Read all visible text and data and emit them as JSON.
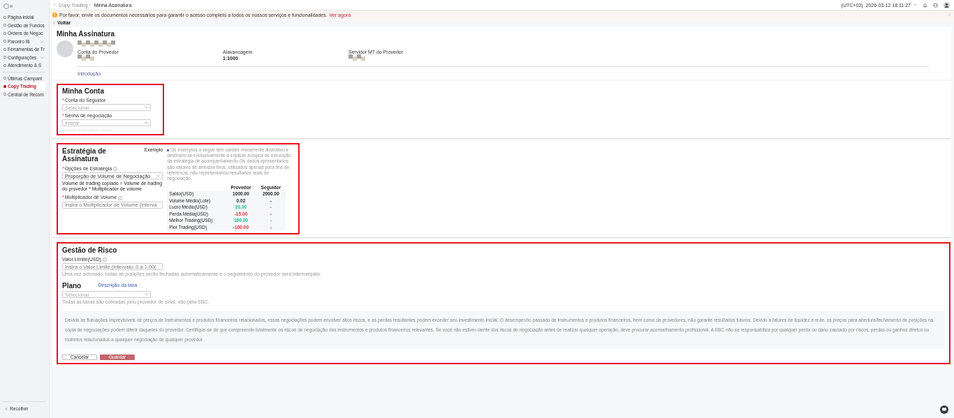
{
  "sidebar": {
    "groups": [
      {
        "items": [
          {
            "label": "Página inicial",
            "selected": false,
            "expandable": false
          },
          {
            "label": "Gestão de Fundos",
            "selected": false,
            "expandable": false
          },
          {
            "label": "Ordens de Negoc",
            "selected": false,
            "expandable": false
          },
          {
            "label": "Parceiro IB",
            "selected": false,
            "expandable": true
          },
          {
            "label": "Ferramentas de Tr",
            "selected": false,
            "expandable": false
          },
          {
            "label": "Configurações",
            "selected": false,
            "expandable": true
          },
          {
            "label": "Atendimento & S",
            "selected": false,
            "expandable": false
          }
        ]
      },
      {
        "items": [
          {
            "label": "Últimas Campant",
            "selected": false,
            "expandable": false
          },
          {
            "label": "Copy Trading",
            "selected": true,
            "expandable": false
          },
          {
            "label": "Central de Recom",
            "selected": false,
            "expandable": false
          }
        ]
      }
    ],
    "collapse": "Recolher"
  },
  "breadcrumb": [
    {
      "label": "Copy Trading",
      "current": false
    },
    {
      "label": "Minha Assinatura",
      "current": true
    }
  ],
  "header": {
    "timezone": "(UTC+03)",
    "datetime": "2026-03-12 18:11:27"
  },
  "notice": {
    "text": "Por favor, envie os documentos necessários para garantir o acesso completo a todos os nossos serviços e funcionalidades.",
    "link": "Ver agora"
  },
  "back": "Voltar",
  "subscription": {
    "title": "Minha Assinatura",
    "fields": [
      {
        "label": "Conta do Provedor"
      },
      {
        "label": "Alavancagem",
        "value": "1:1000"
      },
      {
        "label": "Servidor MT do Provedor"
      }
    ],
    "tab": "Introdução"
  },
  "my_account": {
    "title": "Minha Conta",
    "highlighted": true,
    "fields": [
      {
        "label": "Conta do Seguidor",
        "required_mark": "*",
        "kind": "select",
        "placeholder": "Selecionar"
      },
      {
        "label": "Senha de negociação",
        "required_mark": "*",
        "kind": "password",
        "placeholder": "Insirar"
      }
    ]
  },
  "strategy": {
    "title": "Estratégia de Assinatura",
    "highlighted": true,
    "example_label": "Exemplo",
    "options_label": "Opções de Estratégia",
    "options_required_mark": "*",
    "multiplier_required_mark": "*",
    "option_value": "Proporção de Volume de Negociação",
    "formula": "Volume de trading copiado = Volume de trading do provedor * Multiplicador de volume",
    "multiplier_label": "Multiplicador de Volume",
    "multiplier_placeholder": "Insira o Multiplicador de Volume (interva",
    "example_note": "Os exemplos a seguir têm caráter meramente ilustrativo e destinam-se exclusivamente a explicar a lógica de execução da estratégia de acompanhamento.Os dados apresentados são valores de amostra fixos, utilizados apenas para fins de referência, não representando resultados reais de negociação.",
    "table": {
      "columns": [
        "Provedor",
        "Seguidor"
      ],
      "rows": [
        {
          "label": "Saldo(USD)",
          "provider": {
            "text": "1000.00",
            "kind": "neutral"
          },
          "follower": {
            "text": "2000.00",
            "kind": "neutral"
          }
        },
        {
          "label": "Volume Médio(Lote)",
          "provider": {
            "text": "0.02",
            "kind": "neutral"
          },
          "follower": {
            "text": "-",
            "kind": "neutral"
          }
        },
        {
          "label": "Lucro Médio(USD)",
          "provider": {
            "text": "20.00",
            "kind": "gain"
          },
          "follower": {
            "text": "-",
            "kind": "gain"
          }
        },
        {
          "label": "Perda Média(USD)",
          "provider": {
            "text": "-15.00",
            "kind": "loss"
          },
          "follower": {
            "text": "-",
            "kind": "loss"
          }
        },
        {
          "label": "Melhor Trading(USD)",
          "provider": {
            "text": "160.00",
            "kind": "gain"
          },
          "follower": {
            "text": "-",
            "kind": "gain"
          }
        },
        {
          "label": "Pior Trading(USD)",
          "provider": {
            "text": "-100.00",
            "kind": "loss"
          },
          "follower": {
            "text": "-",
            "kind": "loss"
          }
        }
      ]
    }
  },
  "risk": {
    "title": "Gestão de Risco",
    "highlighted": true,
    "limit_label": "Valor Limite(USD)",
    "limit_placeholder": "Insira o Valor Limite (intervalo: 0 a 1.00(",
    "limit_hint": "Uma vez acionado, todas as posições serão fechadas automaticamente e o seguimento do provedor será interrompido.",
    "plan_title": "Plano",
    "fee_link": "Descrição da taxa",
    "plan_placeholder": "Selecionar",
    "plan_hint": "Todas as taxas são cobradas pelo provedor de sinal, não pela EBC.",
    "disclaimer": "Devido às flutuações imprevisíveis de preços de instrumentos e produtos financeiros relacionados, essas negociações podem envolver altos riscos, e as perdas resultantes podem exceder seu investimento inicial. O desempenho passado de instrumentos e produtos financeiros, bem como de provedores, não garante resultados futuros. Devido a fatores de liquidez e rede, os preços para abertura/fechamento de posições na cópia de negociações podem diferir daqueles do provedor. Certifique-se de que compreende totalmente os riscos de negociação dos instrumentos e produtos financeiros relevantes. Se você não estiver ciente dos riscos de negociação antes de realizar qualquer operação, deve procurar aconselhamento profissional. A EBC não se responsabiliza por qualquer perda ou dano causado por riscos, perdas ou ganhos diretos ou indiretos relacionados a qualquer negociação de qualquer provedor.",
    "buttons": [
      {
        "label": "Cancelar",
        "kind": "secondary"
      },
      {
        "label": "Guardar",
        "kind": "primary"
      }
    ]
  }
}
